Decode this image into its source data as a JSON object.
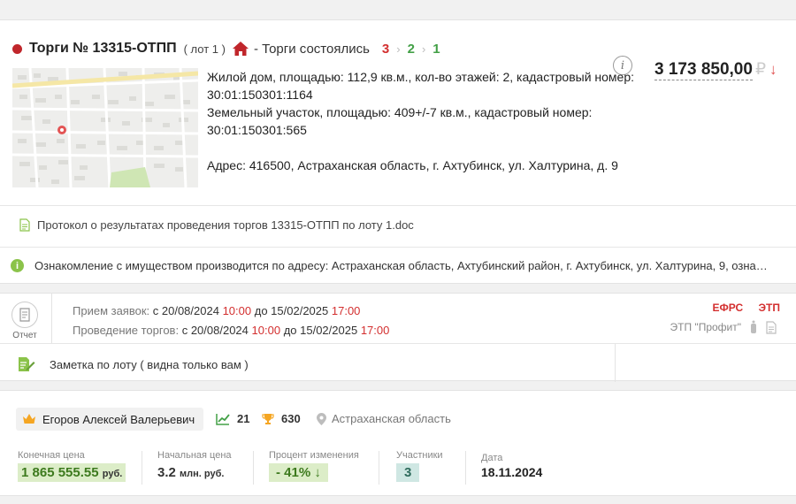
{
  "lot": {
    "title": "Торги № 13315-ОТПП",
    "lot_label": "( лот 1 )",
    "status": "- Торги состоялись",
    "step1": "3",
    "step2": "2",
    "step3": "1",
    "price": "3 173 850,00",
    "currency": "₽",
    "description_line1": "Жилой дом, площадью: 112,9 кв.м., кол-во этажей: 2, кадастровый номер:",
    "description_line2": "30:01:150301:1164",
    "description_line3": "Земельный участок, площадью: 409+/-7 кв.м., кадастровый номер:",
    "description_line4": "30:01:150301:565",
    "address": "Адрес: 416500, Астраханская область, г. Ахтубинск, ул. Халтурина, д. 9",
    "protocol": "Протокол о результатах проведения торгов 13315-ОТПП по лоту 1.doc",
    "notice": "Ознакомление с имуществом производится по адресу: Астраханская область, Ахтубинский район, г. Ахтубинск, ул. Халтурина, 9, озна…"
  },
  "schedule": {
    "report_label": "Отчет",
    "applications_label": "Прием заявок:",
    "applications_from": "с 20/08/2024",
    "applications_from_time": "10:00",
    "applications_to": "до 15/02/2025",
    "applications_to_time": "17:00",
    "auction_label": "Проведение торгов:",
    "auction_from": "с 20/08/2024",
    "auction_from_time": "10:00",
    "auction_to": "до 15/02/2025",
    "auction_to_time": "17:00",
    "tag_efrs": "ЕФРС",
    "tag_etp": "ЭТП",
    "platform": "ЭТП \"Профит\"",
    "note": "Заметка по лоту ( видна только вам )"
  },
  "result": {
    "winner": "Егоров Алексей Валерьевич",
    "wins": "21",
    "trophies": "630",
    "region": "Астраханская область",
    "final_price_label": "Конечная цена",
    "final_price": "1 865 555.55",
    "final_price_unit": "руб.",
    "start_price_label": "Начальная цена",
    "start_price": "3.2",
    "start_price_unit": "млн. руб.",
    "change_label": "Процент изменения",
    "change": "- 41% ↓",
    "participants_label": "Участники",
    "participants": "3",
    "date_label": "Дата",
    "date": "18.11.2024"
  },
  "colors": {
    "accent_red": "#d32f2f",
    "accent_green": "#43a047",
    "badge_green": "#dcedc8"
  },
  "icons": [
    "house-icon",
    "info-icon",
    "down-arrow-icon",
    "map-pin-icon",
    "document-icon",
    "info-circle-icon",
    "report-icon",
    "phone-icon",
    "doc-icon",
    "note-icon",
    "crown-icon",
    "chart-icon",
    "trophy-icon",
    "location-icon"
  ]
}
